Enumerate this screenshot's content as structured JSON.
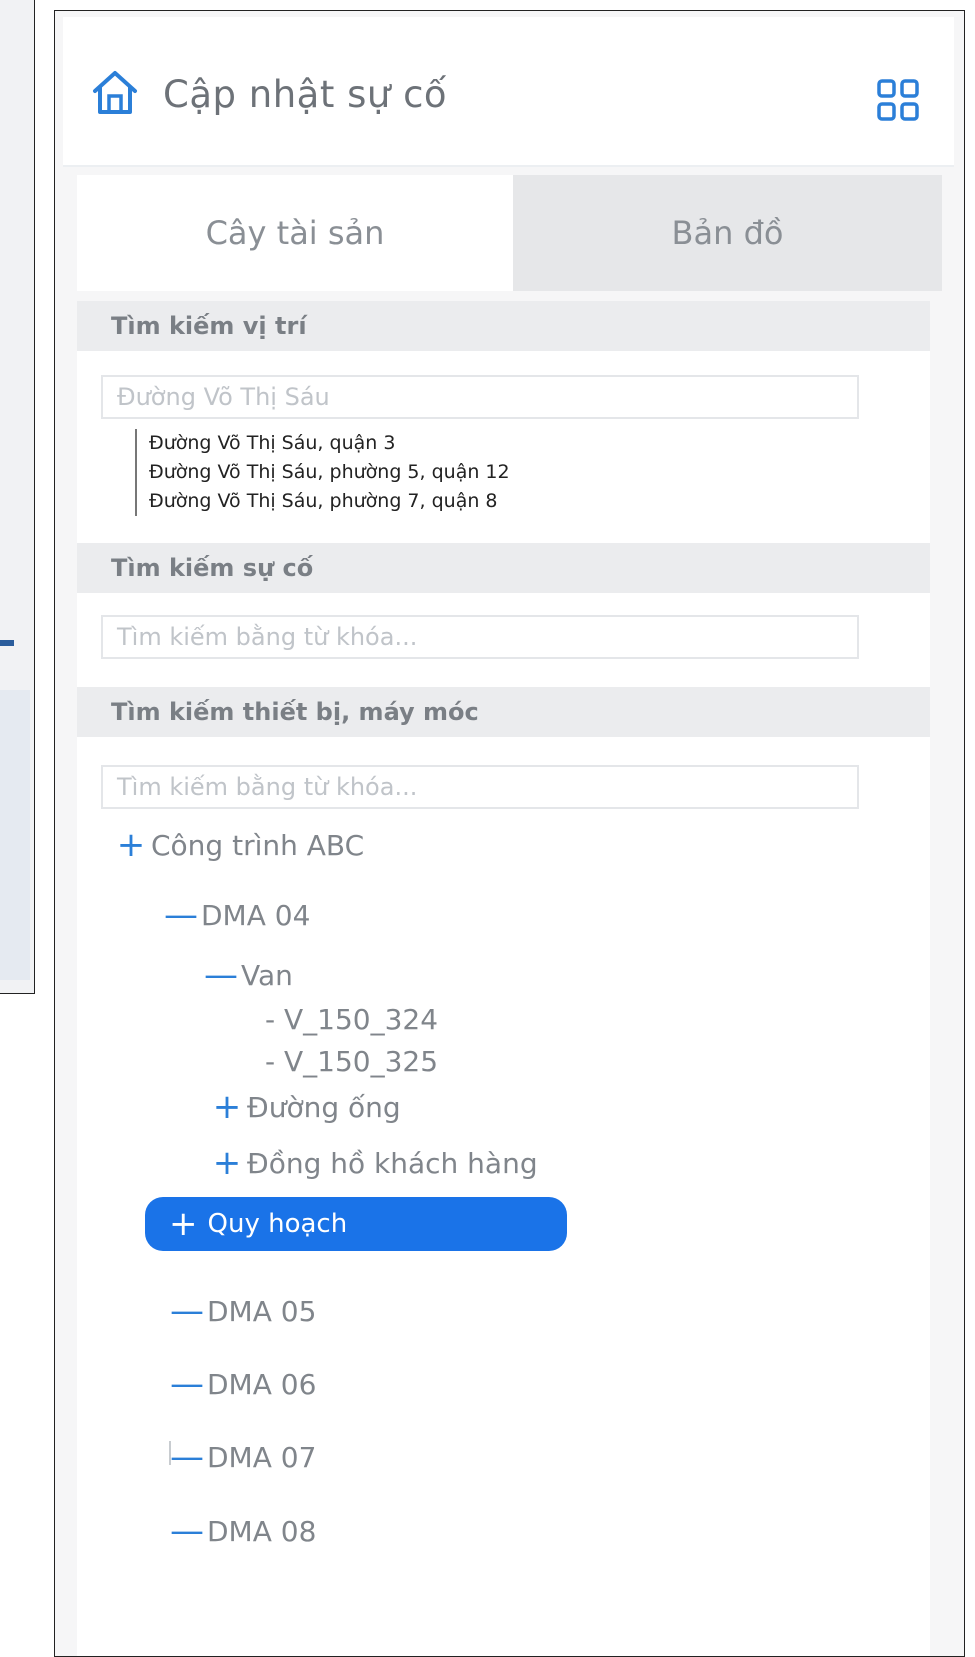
{
  "header": {
    "title": "Cập nhật sự cố"
  },
  "tabs": [
    {
      "label": "Cây tài sản"
    },
    {
      "label": "Bản đồ"
    }
  ],
  "sections": {
    "location": {
      "title": "Tìm kiếm vị trí",
      "input_value": "Đường Võ Thị Sáu",
      "suggestions": [
        "Đường Võ Thị Sáu, quận 3",
        "Đường Võ Thị Sáu, phường 5, quận 12",
        "Đường Võ Thị Sáu, phường 7, quận 8"
      ]
    },
    "incident": {
      "title": "Tìm kiếm sự cố",
      "placeholder": "Tìm kiếm bằng từ khóa..."
    },
    "equipment": {
      "title": "Tìm kiếm thiết bị, máy móc",
      "placeholder": "Tìm kiếm bằng từ khóa..."
    }
  },
  "tree": {
    "root": "Công trình ABC",
    "dma04": "DMA 04",
    "van": "Van",
    "van_items": [
      "- V_150_324",
      "- V_150_325"
    ],
    "duong_ong": "Đường ống",
    "dong_ho": "Đồng hồ khách hàng",
    "quy_hoach": "Quy hoạch",
    "dma_others": [
      "DMA 05",
      "DMA 06",
      "DMA 07",
      "DMA 08"
    ]
  },
  "colors": {
    "accent": "#1a73e8",
    "icon_blue": "#2b7fd8"
  }
}
